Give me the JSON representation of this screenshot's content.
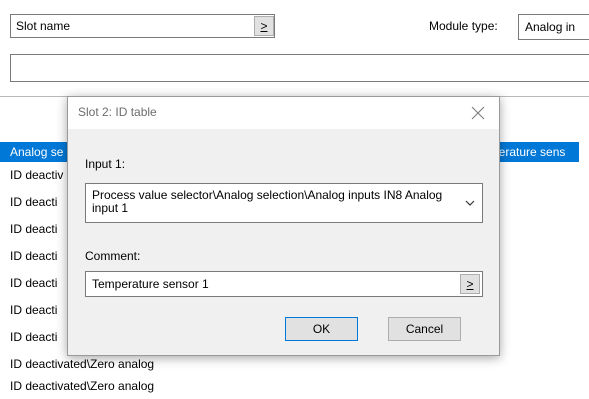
{
  "window": {
    "slot_name_value": "Slot name",
    "browse_label": ">",
    "module_type_label": "Module type:",
    "module_type_value": "Analog in",
    "description_value": ""
  },
  "list": {
    "rows": [
      {
        "left_text": "Analog se",
        "right_text": "perature sens",
        "selected": true
      },
      {
        "left_text": "ID deactiv",
        "right_text": "",
        "selected": false
      },
      {
        "left_text": "ID deacti",
        "right_text": "",
        "selected": false
      },
      {
        "left_text": "ID deacti",
        "right_text": "",
        "selected": false
      },
      {
        "left_text": "ID deacti",
        "right_text": "",
        "selected": false
      },
      {
        "left_text": "ID deacti",
        "right_text": "",
        "selected": false
      },
      {
        "left_text": "ID deacti",
        "right_text": "",
        "selected": false
      },
      {
        "left_text": "ID deacti",
        "right_text": "",
        "selected": false
      },
      {
        "left_text": "ID deactivated\\Zero analog",
        "right_text": "",
        "selected": false
      },
      {
        "left_text": "ID deactivated\\Zero analog",
        "right_text": "",
        "selected": false
      }
    ]
  },
  "dialog": {
    "title": "Slot 2: ID table",
    "close_icon": "close-icon",
    "input_label": "Input 1:",
    "input_value": "Process value selector\\Analog selection\\Analog inputs IN8 Analog input 1",
    "comment_label": "Comment:",
    "comment_value": "Temperature sensor 1",
    "comment_browse_label": ">",
    "ok_label": "OK",
    "cancel_label": "Cancel"
  },
  "colors": {
    "selection": "#0078d7",
    "dialog_bg": "#f0f0f0",
    "button_bg": "#e1e1e1"
  }
}
